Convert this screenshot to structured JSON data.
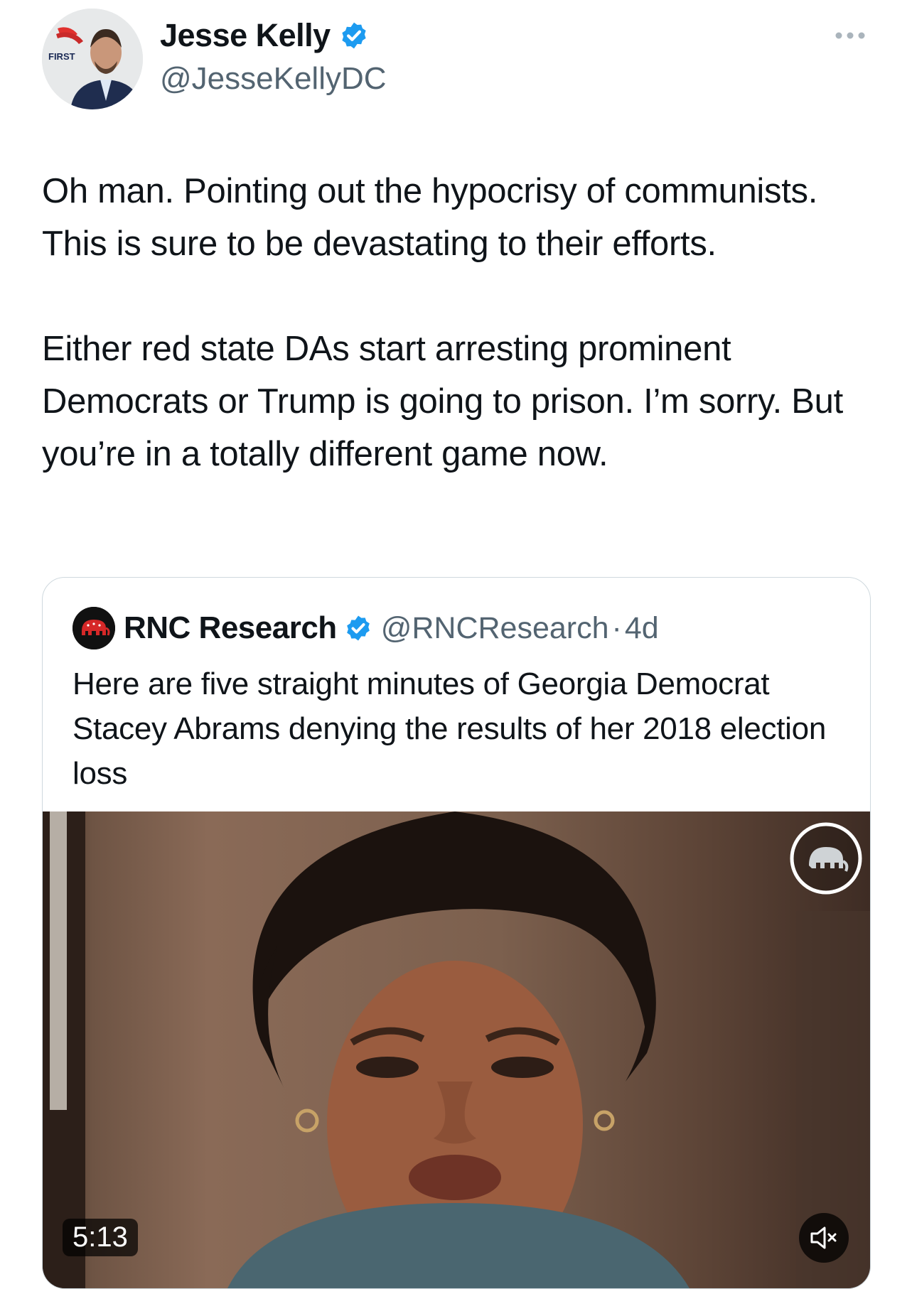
{
  "author": {
    "name": "Jesse Kelly",
    "handle": "@JesseKellyDC",
    "verified_color": "#1d9bf0",
    "avatar_badge_text": "FIRST"
  },
  "tweet": {
    "text": "Oh man. Pointing out the hypocrisy of communists. This is sure to be devastating to their efforts.\n\nEither red state DAs start arresting prominent Democrats or Trump is going to prison. I’m sorry. But you’re in a totally different game now."
  },
  "quote": {
    "name": "RNC Research",
    "handle": "@RNCResearch",
    "separator": "·",
    "time": "4d",
    "text": "Here are five straight minutes of Georgia Democrat Stacey Abrams denying the results of her 2018 election loss",
    "video": {
      "duration": "5:13",
      "icons": [
        "watermark-icon",
        "mute-icon"
      ]
    }
  }
}
